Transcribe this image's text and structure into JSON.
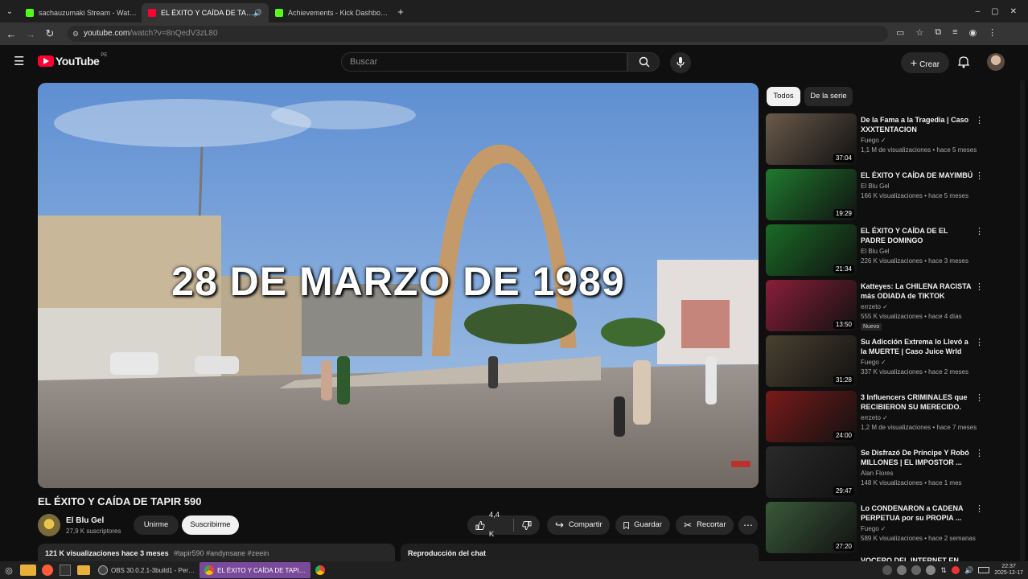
{
  "browser": {
    "tabs": [
      {
        "title": "sachauzumaki Stream - Wat…",
        "color": "#53fc18"
      },
      {
        "title": "EL ÉXITO Y CAÍDA DE TA…",
        "color": "#ff0033",
        "active": true
      },
      {
        "title": "Achievements - Kick Dashbo…",
        "color": "#53fc18"
      }
    ],
    "new_tab": "+",
    "url_domain": "youtube.com",
    "url_path": "/watch?v=8nQedV3zL80",
    "window_controls": [
      "–",
      "▢",
      "✕"
    ]
  },
  "youtube": {
    "logo_text": "YouTube",
    "region": "PE",
    "search_placeholder": "Buscar",
    "create_label": "Crear"
  },
  "video": {
    "overlay_text": "28 DE MARZO DE 1989",
    "title": "EL ÉXITO Y CAÍDA DE TAPIR 590",
    "channel": "El Blu Gel",
    "subscribers": "27,9 K suscriptores",
    "join_label": "Unirme",
    "subscribe_label": "Suscribirme",
    "likes": "4,4 K",
    "share_label": "Compartir",
    "save_label": "Guardar",
    "clip_label": "Recortar",
    "desc_views": "121 K visualizaciones  hace 3 meses",
    "desc_tags": "#tapir590 #andynsane #zeein",
    "chat_label": "Reproducción del chat"
  },
  "sidebar": {
    "chips": [
      "Todos",
      "De la serie"
    ],
    "items": [
      {
        "title": "De la Fama a la Tragedia | Caso XXXTENTACION",
        "channel": "Fuego ✓",
        "meta": "1,1 M de visualizaciones • hace 5 meses",
        "duration": "37:04",
        "bg": "#6a5a4a"
      },
      {
        "title": "EL ÉXITO Y CAÍDA DE MAYIMBÚ",
        "channel": "El Blu Gel",
        "meta": "166 K visualizaciones • hace 5 meses",
        "duration": "19:29",
        "bg": "#1f7a2e"
      },
      {
        "title": "EL ÉXITO Y CAÍDA DE EL PADRE DOMINGO",
        "channel": "El Blu Gel",
        "meta": "226 K visualizaciones • hace 3 meses",
        "duration": "21:34",
        "bg": "#1a6b26"
      },
      {
        "title": "Katteyes: La CHILENA RACISTA más ODIADA de TIKTOK",
        "channel": "errzeto ✓",
        "meta": "555 K visualizaciones • hace 4 días",
        "duration": "13:50",
        "badge": "Nuevo",
        "bg": "#8a1e3a"
      },
      {
        "title": "Su Adicción Extrema lo Llevó a la MUERTE | Caso Juice Wrld",
        "channel": "Fuego ✓",
        "meta": "337 K visualizaciones • hace 2 meses",
        "duration": "31:28",
        "bg": "#4a4030"
      },
      {
        "title": "3 Influencers CRIMINALES que RECIBIERON SU MERECIDO.",
        "channel": "errzeto ✓",
        "meta": "1,2 M de visualizaciones • hace 7 meses",
        "duration": "24:00",
        "bg": "#7a1a1a"
      },
      {
        "title": "Se Disfrazó De Príncipe Y Robó MILLONES | EL IMPOSTOR ...",
        "channel": "Alan Flores",
        "meta": "148 K visualizaciones • hace 1 mes",
        "duration": "29:47",
        "bg": "#2a2a2a"
      },
      {
        "title": "Lo CONDENARON a CADENA PERPETUA por su PROPIA ...",
        "channel": "Fuego ✓",
        "meta": "589 K visualizaciones • hace 2 semanas",
        "duration": "27:20",
        "bg": "#3a5a3a"
      }
    ],
    "partial_title": "VOCERO DEL INTERNET EN"
  },
  "taskbar": {
    "obs_label": "OBS 30.0.2.1-3build1 - Per…",
    "yt_label": "EL ÉXITO Y CAÍDA DE TAPI…",
    "clock_time": "22:37",
    "clock_date": "2025-12-17"
  },
  "colors": {
    "yt_red": "#ff0033",
    "kick_green": "#53fc18",
    "bg": "#0f0f0f"
  }
}
